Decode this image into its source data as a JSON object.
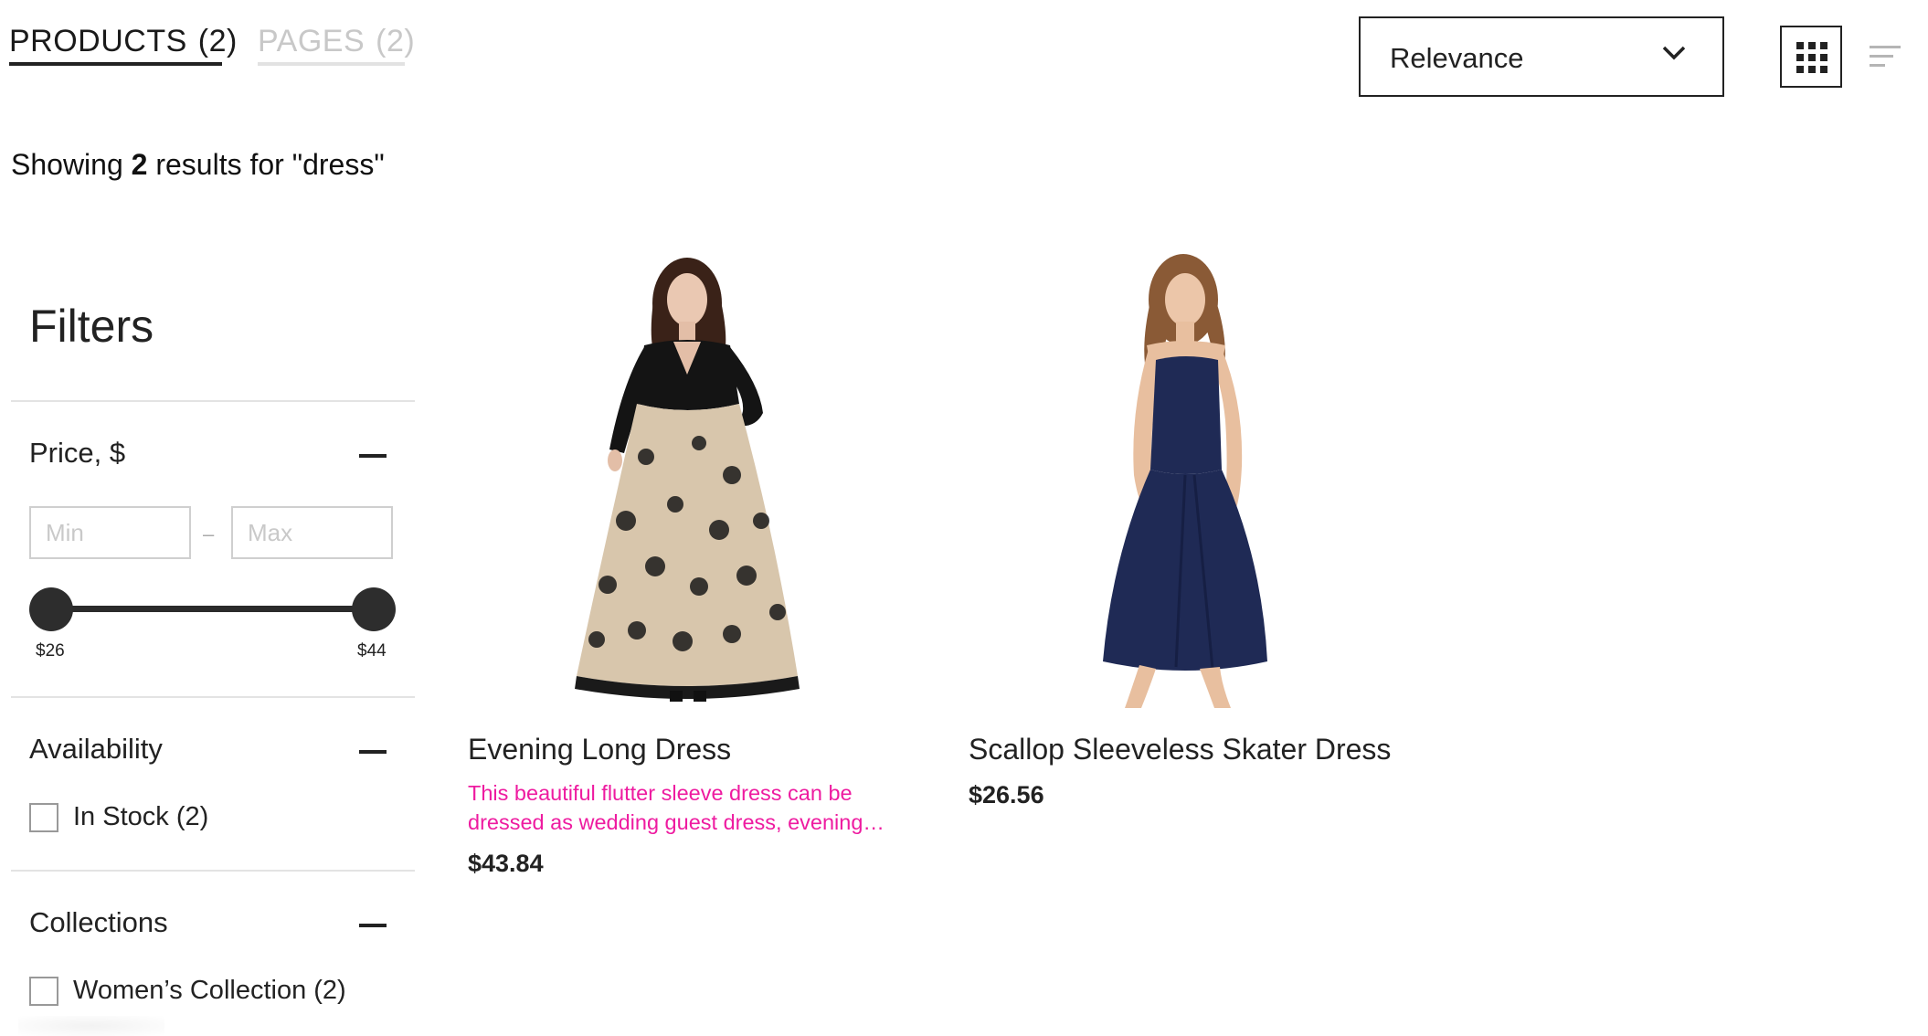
{
  "tabs": [
    {
      "label": "PRODUCTS",
      "count": "(2)",
      "active": true
    },
    {
      "label": "PAGES",
      "count": "(2)",
      "active": false
    }
  ],
  "sort": {
    "selected": "Relevance"
  },
  "view_controls": {
    "grid_icon": "grid-icon",
    "list_icon": "list-icon"
  },
  "results": {
    "prefix": "Showing",
    "count": "2",
    "suffix": "results for \"dress\""
  },
  "filters": {
    "title": "Filters",
    "price": {
      "title": "Price, $",
      "min_placeholder": "Min",
      "max_placeholder": "Max",
      "dash": "–",
      "slider_min_label": "$26",
      "slider_max_label": "$44"
    },
    "availability": {
      "title": "Availability",
      "options": [
        {
          "label": "In Stock (2)",
          "checked": false
        }
      ]
    },
    "collections": {
      "title": "Collections",
      "options": [
        {
          "label": "Women’s Collection (2)",
          "checked": false
        }
      ]
    }
  },
  "products": [
    {
      "name": "Evening Long Dress",
      "description": "This beautiful flutter sleeve dress can be dressed as wedding guest dress, evening…",
      "price": "$43.84"
    },
    {
      "name": "Scallop Sleeveless Skater Dress",
      "price": "$26.56"
    }
  ],
  "colors": {
    "accent_pink": "#ee1ba0",
    "text": "#222222",
    "inactive_tab": "#c8c8c8"
  }
}
